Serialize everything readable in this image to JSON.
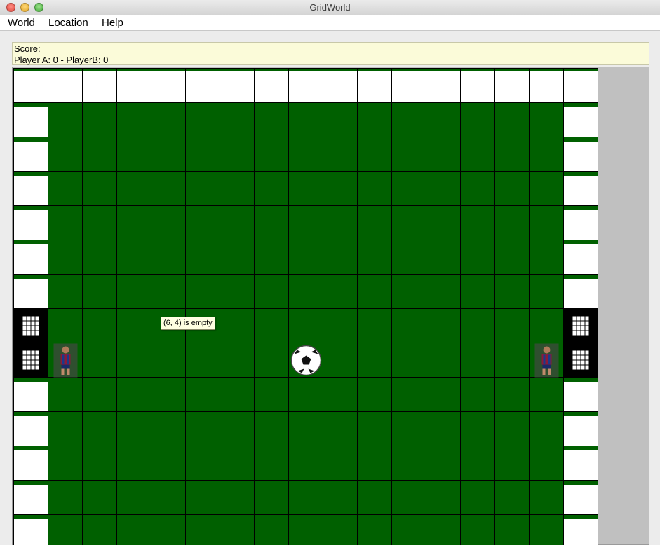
{
  "window": {
    "title": "GridWorld"
  },
  "menu": {
    "items": [
      "World",
      "Location",
      "Help"
    ]
  },
  "score": {
    "heading": "Score:",
    "line": "Player A: 0 - PlayerB: 0"
  },
  "tooltip": {
    "text": "(6, 4) is empty"
  },
  "colors": {
    "field": "#006000",
    "wall": "#ffffff",
    "goal": "#000000",
    "gridline": "#000000",
    "stripe": "#006000"
  },
  "grid": {
    "columns": 17,
    "visible_rows": 14,
    "goal_rows": [
      7,
      8
    ],
    "pieces": [
      {
        "type": "player",
        "icon": "player-a-icon",
        "row": 8,
        "col": 1
      },
      {
        "type": "ball",
        "icon": "soccer-ball-icon",
        "row": 8,
        "col": 8
      },
      {
        "type": "player",
        "icon": "player-b-icon",
        "row": 8,
        "col": 15
      }
    ]
  }
}
